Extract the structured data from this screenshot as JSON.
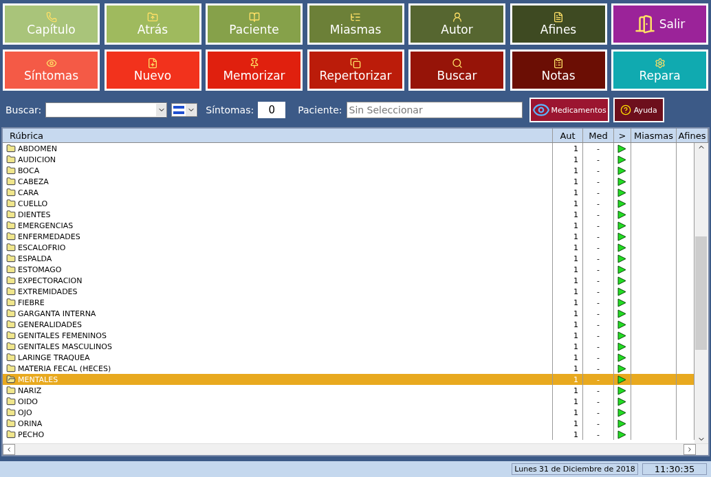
{
  "buttons": [
    {
      "label": "Capítulo",
      "kind": "stacked",
      "color": "#a9c47a"
    },
    {
      "label": "Atrás",
      "kind": "stacked",
      "color": "#9fba5e"
    },
    {
      "label": "Paciente",
      "kind": "stacked",
      "color": "#86a14a"
    },
    {
      "label": "Miasmas",
      "kind": "stacked",
      "color": "#6c8038"
    },
    {
      "label": "Autor",
      "kind": "stacked",
      "color": "#566630"
    },
    {
      "label": "Afines",
      "kind": "stacked",
      "color": "#3e4a22"
    },
    {
      "label": "Salir",
      "kind": "inline",
      "color": "#9b2399"
    },
    {
      "label": "Síntomas",
      "kind": "stacked",
      "color": "#f45a46"
    },
    {
      "label": "Nuevo",
      "kind": "stacked",
      "color": "#f2321c"
    },
    {
      "label": "Memorizar",
      "kind": "stacked",
      "color": "#e0200e"
    },
    {
      "label": "Repertorizar",
      "kind": "stacked",
      "color": "#bb1c0a"
    },
    {
      "label": "Buscar",
      "kind": "stacked",
      "color": "#961408"
    },
    {
      "label": "Notas",
      "kind": "stacked",
      "color": "#6b0e04"
    },
    {
      "label": "Repara",
      "kind": "stacked",
      "color": "#10aab0"
    }
  ],
  "toolbar": {
    "search_label": "Buscar:",
    "symptoms_label": "Síntomas:",
    "symptoms_value": "0",
    "patient_label": "Paciente:",
    "patient_placeholder": "Sin Seleccionar",
    "medicamentos": "Medicamentos",
    "ayuda": "Ayuda"
  },
  "table": {
    "columns": [
      "Rúbrica",
      "Aut",
      "Med",
      ">",
      "Miasmas",
      "Afines"
    ],
    "rows": [
      {
        "name": "ABDOMEN",
        "aut": "1",
        "med": "-",
        "selected": false
      },
      {
        "name": "AUDICION",
        "aut": "1",
        "med": "-",
        "selected": false
      },
      {
        "name": "BOCA",
        "aut": "1",
        "med": "-",
        "selected": false
      },
      {
        "name": "CABEZA",
        "aut": "1",
        "med": "-",
        "selected": false
      },
      {
        "name": "CARA",
        "aut": "1",
        "med": "-",
        "selected": false
      },
      {
        "name": "CUELLO",
        "aut": "1",
        "med": "-",
        "selected": false
      },
      {
        "name": "DIENTES",
        "aut": "1",
        "med": "-",
        "selected": false
      },
      {
        "name": "EMERGENCIAS",
        "aut": "1",
        "med": "-",
        "selected": false
      },
      {
        "name": "ENFERMEDADES",
        "aut": "1",
        "med": "-",
        "selected": false
      },
      {
        "name": "ESCALOFRIO",
        "aut": "1",
        "med": "-",
        "selected": false
      },
      {
        "name": "ESPALDA",
        "aut": "1",
        "med": "-",
        "selected": false
      },
      {
        "name": "ESTOMAGO",
        "aut": "1",
        "med": "-",
        "selected": false
      },
      {
        "name": "EXPECTORACION",
        "aut": "1",
        "med": "-",
        "selected": false
      },
      {
        "name": "EXTREMIDADES",
        "aut": "1",
        "med": "-",
        "selected": false
      },
      {
        "name": "FIEBRE",
        "aut": "1",
        "med": "-",
        "selected": false
      },
      {
        "name": "GARGANTA INTERNA",
        "aut": "1",
        "med": "-",
        "selected": false
      },
      {
        "name": "GENERALIDADES",
        "aut": "1",
        "med": "-",
        "selected": false
      },
      {
        "name": "GENITALES FEMENINOS",
        "aut": "1",
        "med": "-",
        "selected": false
      },
      {
        "name": "GENITALES  MASCULINOS",
        "aut": "1",
        "med": "-",
        "selected": false
      },
      {
        "name": "LARINGE TRAQUEA",
        "aut": "1",
        "med": "-",
        "selected": false
      },
      {
        "name": "MATERIA FECAL (HECES)",
        "aut": "1",
        "med": "-",
        "selected": false
      },
      {
        "name": "MENTALES",
        "aut": "1",
        "med": "-",
        "selected": true
      },
      {
        "name": "NARIZ",
        "aut": "1",
        "med": "-",
        "selected": false
      },
      {
        "name": "OIDO",
        "aut": "1",
        "med": "-",
        "selected": false
      },
      {
        "name": "OJO",
        "aut": "1",
        "med": "-",
        "selected": false
      },
      {
        "name": "ORINA",
        "aut": "1",
        "med": "-",
        "selected": false
      },
      {
        "name": "PECHO",
        "aut": "1",
        "med": "-",
        "selected": false
      }
    ]
  },
  "status_bar": {
    "date": "Lunes 31 de Diciembre de 2018",
    "time": "11:30:35"
  }
}
